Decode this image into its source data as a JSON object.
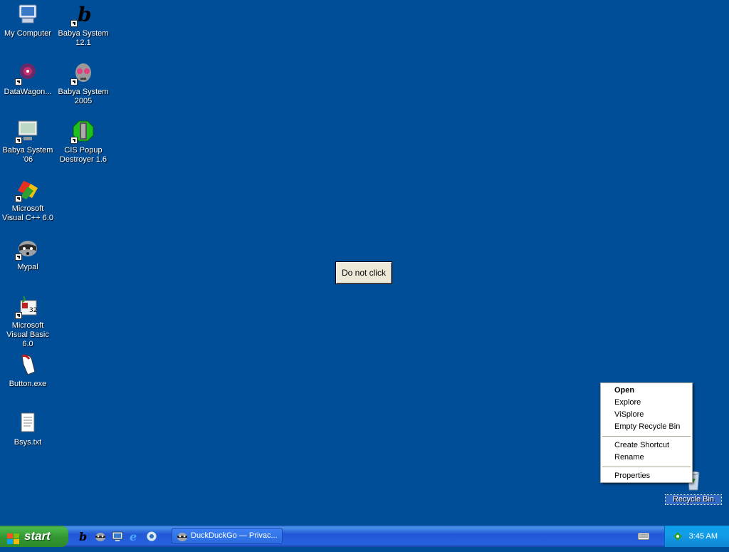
{
  "desktop": {
    "icons": [
      {
        "label": "My Computer",
        "icon": "my-computer-icon"
      },
      {
        "label": "Babya System 12.1",
        "icon": "babya-b-icon"
      },
      {
        "label": "DataWagon...",
        "icon": "datawagon-icon"
      },
      {
        "label": "Babya System 2005",
        "icon": "babya-alien-icon"
      },
      {
        "label": "Babya System '06",
        "icon": "babya-monitor-icon"
      },
      {
        "label": "CIS Popup Destroyer 1.6",
        "icon": "popup-destroyer-icon"
      },
      {
        "label": "Microsoft Visual C++ 6.0",
        "icon": "visual-cpp-icon"
      },
      {
        "label": "Mypal",
        "icon": "mypal-raccoon-icon"
      },
      {
        "label": "Microsoft Visual Basic 6.0",
        "icon": "visual-basic-icon"
      },
      {
        "label": "Button.exe",
        "icon": "button-exe-icon"
      },
      {
        "label": "Bsys.txt",
        "icon": "text-file-icon"
      },
      {
        "label": "Recycle Bin",
        "icon": "recycle-bin-icon"
      }
    ]
  },
  "floating_button": {
    "label": "Do not click"
  },
  "context_menu": {
    "items": [
      {
        "label": "Open",
        "bold": true
      },
      {
        "label": "Explore"
      },
      {
        "label": "ViSplore"
      },
      {
        "label": "Empty Recycle Bin"
      },
      {
        "label": "Create Shortcut"
      },
      {
        "label": "Rename"
      },
      {
        "label": "Properties"
      }
    ]
  },
  "taskbar": {
    "start_label": "start",
    "quick_launch": [
      "babya-b-icon",
      "raccoon-icon",
      "show-desktop-icon",
      "internet-explorer-icon",
      "browser-icon"
    ],
    "task": {
      "label": "DuckDuckGo — Privac..."
    },
    "tray": {
      "clock": "3:45 AM"
    }
  },
  "colors": {
    "desktop": "#004e98",
    "taskbar": "#245edb",
    "start": "#3c9a3c",
    "tray": "#0f8ed9"
  }
}
